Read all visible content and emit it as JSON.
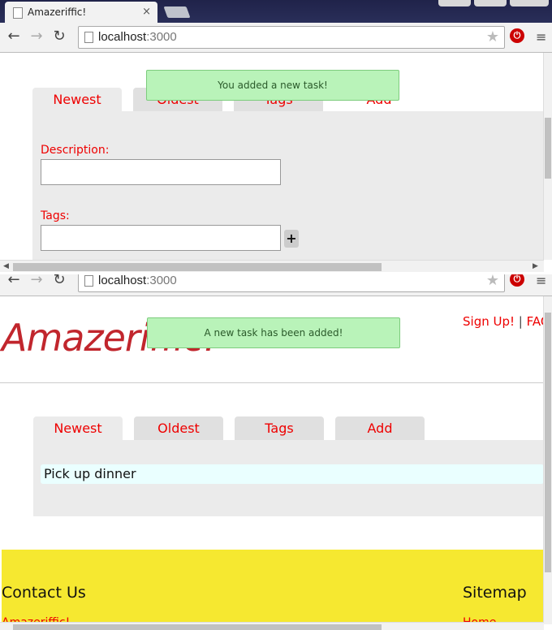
{
  "browser": {
    "tab_title": "Amazeriffic!",
    "tab_close": "×",
    "url_host": "localhost",
    "url_port": ":3000",
    "nav": {
      "back": "←",
      "forward": "→",
      "reload": "↻"
    },
    "star": "★",
    "menu": "≡"
  },
  "window1": {
    "toast": "You added a new task!",
    "tabs": [
      {
        "label": "Newest"
      },
      {
        "label": "Oldest"
      },
      {
        "label": "Tags"
      },
      {
        "label": "Add"
      }
    ],
    "form": {
      "description_label": "Description:",
      "description_value": "",
      "tags_label": "Tags:",
      "tags_value": "",
      "add_tag_button": "+"
    }
  },
  "window2": {
    "toast": "A new task has been added!",
    "logo": "Amazeriffic!",
    "nav": {
      "signup": "Sign Up!",
      "separator": "|",
      "faq": "FAQ"
    },
    "tabs": [
      {
        "label": "Newest"
      },
      {
        "label": "Oldest"
      },
      {
        "label": "Tags"
      },
      {
        "label": "Add"
      }
    ],
    "tasks": [
      "Pick up dinner"
    ],
    "footer": {
      "contact_title": "Contact Us",
      "sitemap_title": "Sitemap",
      "contact_line": "Amazeriffic!",
      "sitemap_line": "Home"
    }
  },
  "colors": {
    "accent": "#e00000",
    "toast_bg": "#b9f3b9",
    "footer_bg": "#f6e830",
    "logo": "#c1262d"
  }
}
